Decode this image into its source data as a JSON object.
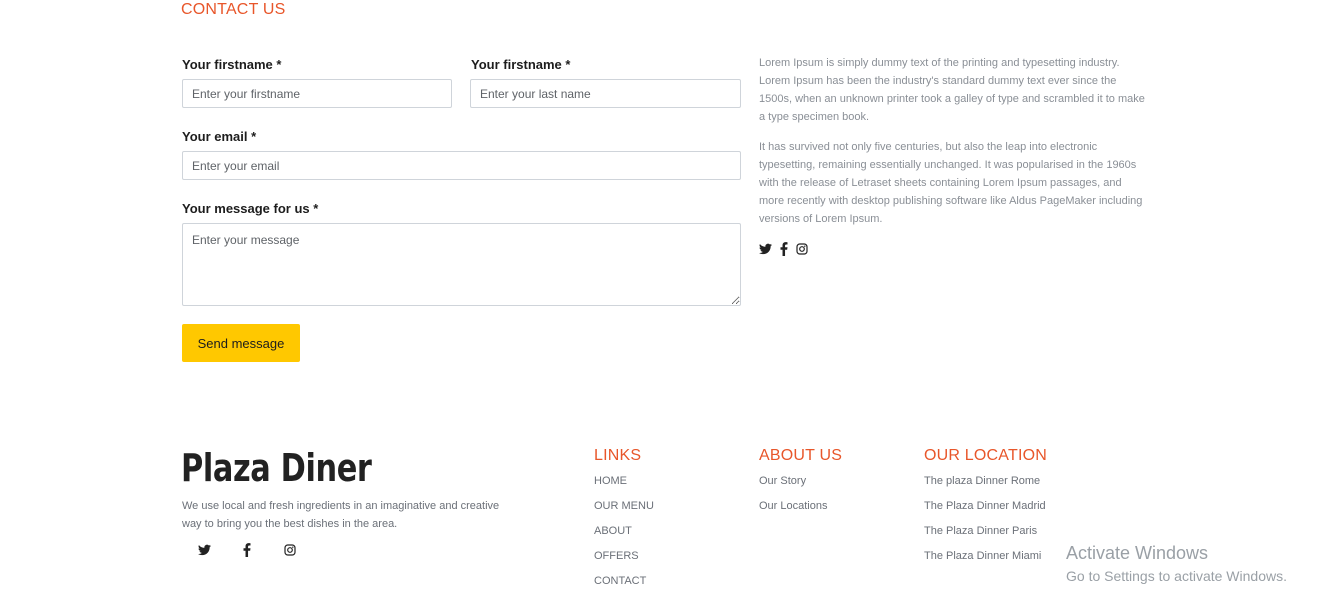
{
  "contact": {
    "title": "CONTACT US",
    "firstname_label": "Your firstname *",
    "firstname_placeholder": "Enter your firstname",
    "lastname_label": "Your firstname *",
    "lastname_placeholder": "Enter your last name",
    "email_label": "Your email *",
    "email_placeholder": "Enter your email",
    "message_label": "Your message for us *",
    "message_placeholder": "Enter your message",
    "send_label": "Send message",
    "paragraph_1": "Lorem Ipsum is simply dummy text of the printing and typesetting industry. Lorem Ipsum has been the industry's standard dummy text ever since the 1500s, when an unknown printer took a galley of type and scrambled it to make a type specimen book.",
    "paragraph_2": "It has survived not only five centuries, but also the leap into electronic typesetting, remaining essentially unchanged. It was popularised in the 1960s with the release of Letraset sheets containing Lorem Ipsum passages, and more recently with desktop publishing software like Aldus PageMaker including versions of Lorem Ipsum.",
    "social_icons": [
      "twitter-icon",
      "facebook-icon",
      "instagram-icon"
    ]
  },
  "footer": {
    "brand": "Plaza Diner",
    "description": "We use local and fresh ingredients in an imaginative and creative way to bring you the best dishes in the area.",
    "social_icons": [
      "twitter-icon",
      "facebook-icon",
      "instagram-icon"
    ],
    "links": {
      "title": "LINKS",
      "items": [
        "HOME",
        "OUR MENU",
        "ABOUT",
        "OFFERS",
        "CONTACT"
      ]
    },
    "about": {
      "title": "ABOUT US",
      "items": [
        "Our Story",
        "Our Locations"
      ]
    },
    "location": {
      "title": "OUR LOCATION",
      "items": [
        "The plaza Dinner Rome",
        "The Plaza Dinner Madrid",
        "The Plaza Dinner Paris",
        "The Plaza Dinner Miami"
      ]
    }
  },
  "watermark": {
    "title": "Activate Windows",
    "subtitle": "Go to Settings to activate Windows."
  },
  "colors": {
    "accent": "#e8562a",
    "button": "#ffc800"
  }
}
